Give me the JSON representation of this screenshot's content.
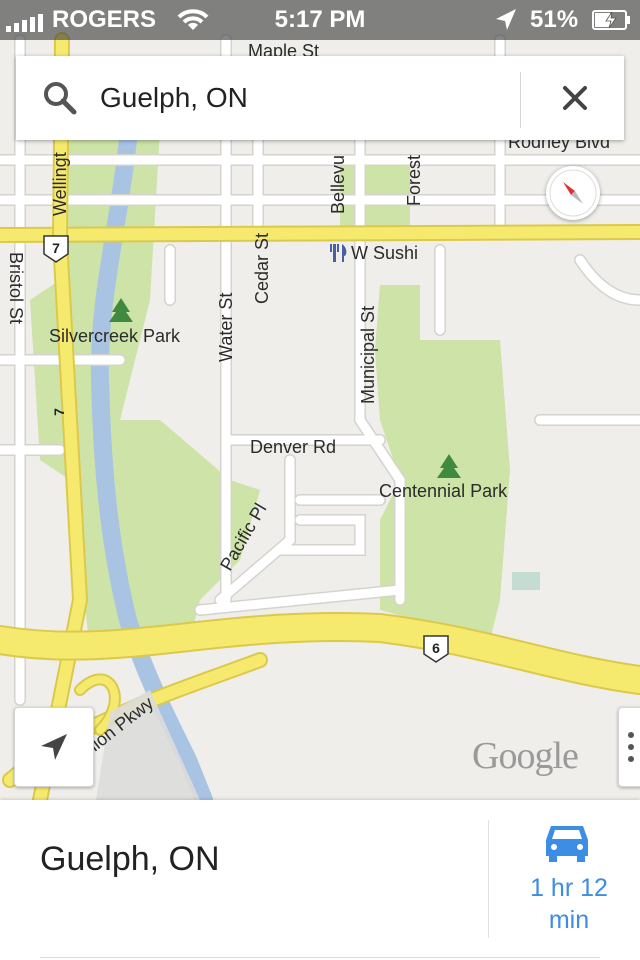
{
  "status_bar": {
    "carrier": "ROGERS",
    "time": "5:17 PM",
    "battery_percent": "51%",
    "signal_bars": 5
  },
  "search": {
    "query": "Guelph, ON",
    "search_icon": "search-icon",
    "clear_icon": "close-icon"
  },
  "map": {
    "streets": {
      "maple": "Maple St",
      "wellington": "Wellingt",
      "bellevue": "Bellevu",
      "forest": "Forest",
      "rodney": "Rodney Blvd",
      "bristol": "Bristol St",
      "water": "Water St",
      "cedar": "Cedar St",
      "municipal": "Municipal St",
      "denver": "Denver Rd",
      "pacific": "Pacific Pl",
      "hanlon": "Hanlon Pkwy"
    },
    "highway_shields": {
      "hwy7_top": "7",
      "hwy7_side": "7",
      "hwy6_right": "6",
      "hwy6_bottom": "6"
    },
    "places": {
      "silvercreek_park": "Silvercreek Park",
      "centennial_park": "Centennial Park",
      "w_sushi": "W Sushi"
    },
    "watermark": "Google",
    "colors": {
      "land": "#efeeea",
      "park": "#cde3a8",
      "river": "#a9c4e3",
      "highway": "#f6ea6e",
      "highway_edge": "#dcc94c",
      "road": "#ffffff",
      "road_edge": "#d4d3ce"
    }
  },
  "controls": {
    "compass_icon": "compass-icon",
    "my_location_icon": "location-arrow-icon",
    "more_icon": "more-vertical-icon"
  },
  "bottom_card": {
    "place_name": "Guelph, ON",
    "route_icon": "car-icon",
    "eta_line1": "1 hr 12",
    "eta_line2": "min",
    "accent_color": "#3c8de3"
  }
}
